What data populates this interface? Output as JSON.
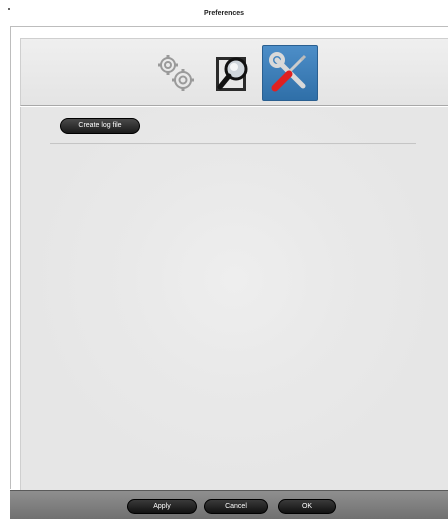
{
  "window": {
    "title": "Preferences"
  },
  "toolbar": {
    "items": [
      {
        "name": "general",
        "icon": "gears-icon",
        "selected": false
      },
      {
        "name": "search",
        "icon": "magnifier-icon",
        "selected": false
      },
      {
        "name": "tools",
        "icon": "tools-icon",
        "selected": true
      }
    ],
    "selected_color": "#2f6fa8"
  },
  "content": {
    "create_log_label": "Create log file"
  },
  "footer": {
    "apply_label": "Apply",
    "cancel_label": "Cancel",
    "ok_label": "OK"
  }
}
